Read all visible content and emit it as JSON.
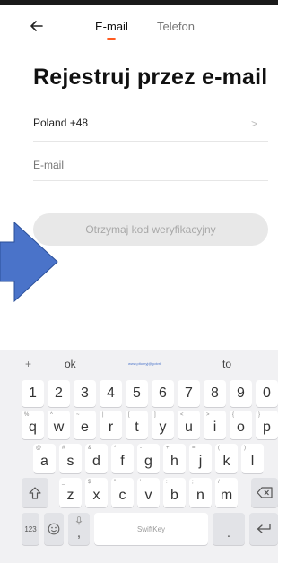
{
  "header": {
    "back_icon": "arrow-left-icon",
    "tabs": [
      {
        "label": "E-mail",
        "active": true
      },
      {
        "label": "Telefon",
        "active": false
      }
    ],
    "accent_color": "#ff5a1f"
  },
  "main": {
    "title": "Rejestruj przez e-mail",
    "country": {
      "value": "Poland +48",
      "chevron_icon": "chevron-right-icon"
    },
    "email": {
      "placeholder": "E-mail",
      "value": ""
    },
    "verify_button": {
      "label": "Otrzymaj kod weryfikacyjny",
      "enabled": false
    }
  },
  "overlay": {
    "arrow_icon": "blue-arrow-right-icon",
    "color": "#4a73c9"
  },
  "keyboard": {
    "suggestions": [
      "+",
      "ok",
      "www.pitomyj@gotvrk",
      "to"
    ],
    "number_row": [
      "1",
      "2",
      "3",
      "4",
      "5",
      "6",
      "7",
      "8",
      "9",
      "0"
    ],
    "row1": [
      {
        "main": "q",
        "sub": "%"
      },
      {
        "main": "w",
        "sub": "^"
      },
      {
        "main": "e",
        "sub": "~"
      },
      {
        "main": "r",
        "sub": "|"
      },
      {
        "main": "t",
        "sub": "["
      },
      {
        "main": "y",
        "sub": "]"
      },
      {
        "main": "u",
        "sub": "<"
      },
      {
        "main": "i",
        "sub": ">"
      },
      {
        "main": "o",
        "sub": "{"
      },
      {
        "main": "p",
        "sub": "}"
      }
    ],
    "row2": [
      {
        "main": "a",
        "sub": "@"
      },
      {
        "main": "s",
        "sub": "#"
      },
      {
        "main": "d",
        "sub": "&"
      },
      {
        "main": "f",
        "sub": "*"
      },
      {
        "main": "g",
        "sub": "-"
      },
      {
        "main": "h",
        "sub": "+"
      },
      {
        "main": "j",
        "sub": "="
      },
      {
        "main": "k",
        "sub": "("
      },
      {
        "main": "l",
        "sub": ")"
      }
    ],
    "row3": [
      {
        "main": "z",
        "sub": "_"
      },
      {
        "main": "x",
        "sub": "$"
      },
      {
        "main": "c",
        "sub": "\""
      },
      {
        "main": "v",
        "sub": "'"
      },
      {
        "main": "b",
        "sub": ":"
      },
      {
        "main": "n",
        "sub": ";"
      },
      {
        "main": "m",
        "sub": "/"
      }
    ],
    "shift_icon": "shift-icon",
    "backspace_icon": "backspace-icon",
    "bottom": {
      "numbers_label": "123",
      "emoji_icon": "emoji-icon",
      "mic_icon": "microphone-icon",
      "comma_label": ",",
      "space_label": "SwiftKey",
      "period_label": ".",
      "enter_icon": "enter-icon"
    }
  }
}
